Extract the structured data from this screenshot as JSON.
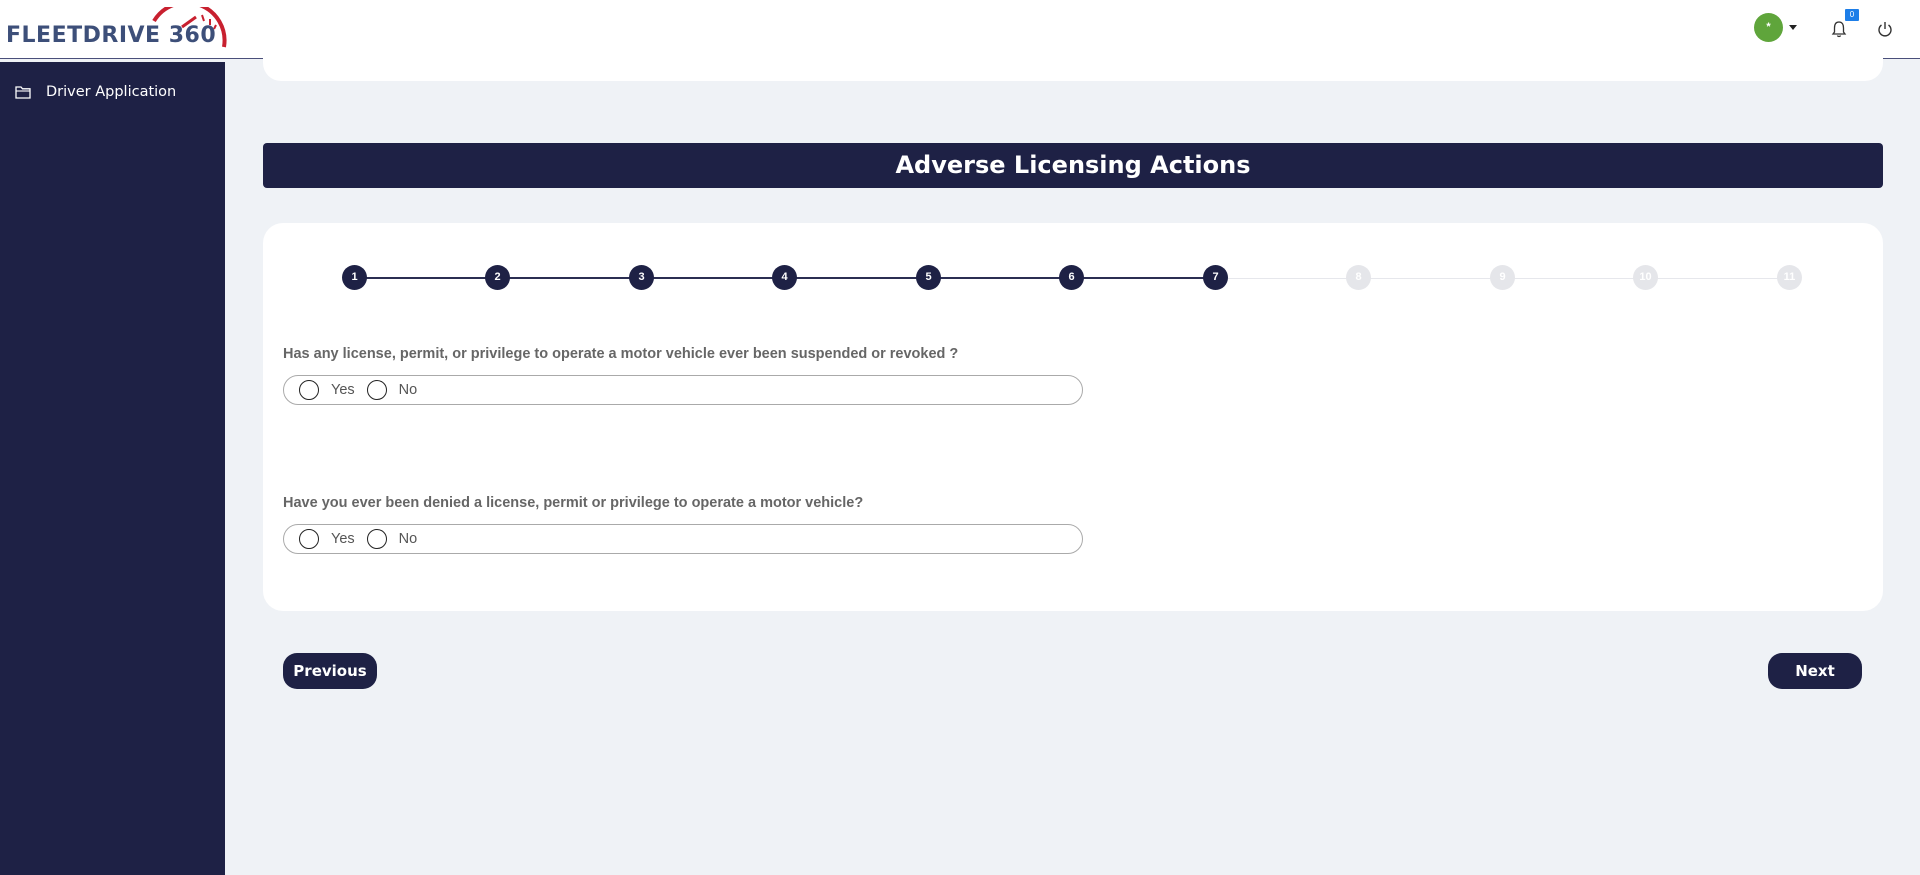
{
  "header": {
    "logo_text": "FLEETDRIVE 360",
    "avatar_text": "*",
    "notification_count": "0",
    "icons": [
      "avatar",
      "chevron-down-icon",
      "bell-icon",
      "power-icon"
    ]
  },
  "sidebar": {
    "items": [
      {
        "label": "Driver Application",
        "icon": "folder-icon"
      }
    ]
  },
  "main": {
    "section_title": "Adverse Licensing Actions",
    "stepper": {
      "steps": [
        "1",
        "2",
        "3",
        "4",
        "5",
        "6",
        "7",
        "8",
        "9",
        "10",
        "11"
      ],
      "current_step": 7
    },
    "questions": [
      {
        "text": "Has any license, permit, or privilege to operate a motor vehicle ever been suspended or revoked ?",
        "options": [
          "Yes",
          "No"
        ],
        "selected": null
      },
      {
        "text": "Have you ever been denied a license, permit or privilege to operate a motor vehicle?",
        "options": [
          "Yes",
          "No"
        ],
        "selected": null
      }
    ],
    "buttons": {
      "previous": "Previous",
      "next": "Next"
    }
  },
  "colors": {
    "navy": "#1e2145",
    "page_bg": "#eff2f6",
    "avatar_green": "#5fa53b",
    "badge_blue": "#1d7ee8",
    "logo_red": "#c8202f",
    "logo_blue": "#3d4f79"
  }
}
